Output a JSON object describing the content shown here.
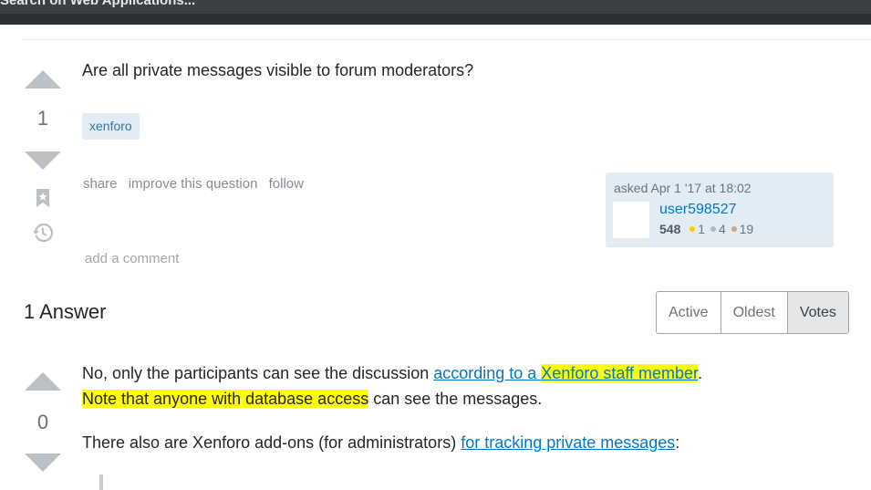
{
  "header": {
    "search_partial_text": "Search on Web Applications..."
  },
  "question": {
    "vote_count": "1",
    "title": "Are all private messages visible to forum moderators?",
    "tags": [
      "xenforo"
    ],
    "menu": {
      "share": "share",
      "improve": "improve this question",
      "follow": "follow"
    },
    "add_comment": "add a comment",
    "asked": {
      "label": "asked Apr 1 '17 at 18:02",
      "user_name": "user598527",
      "reputation": "548",
      "gold": "1",
      "silver": "4",
      "bronze": "19",
      "badge_colors": {
        "gold": "#ffcc01",
        "silver": "#b4b8bc",
        "bronze": "#d1a684"
      }
    }
  },
  "answers": {
    "heading": "1 Answer",
    "sort_tabs": [
      "Active",
      "Oldest",
      "Votes"
    ],
    "selected_tab": "Votes"
  },
  "answer": {
    "vote_count": "0",
    "line1_prefix": "No, only the participants can see the discussion ",
    "line1_link_a": "according to a ",
    "line1_link_b": "Xenforo staff member",
    "line1_suffix": ".",
    "line2_highlight": "Note that anyone with database access",
    "line2_suffix": " can see the messages.",
    "line3_prefix": "There also are Xenforo add-ons (for administrators) ",
    "line3_link": "for tracking private messages",
    "line3_suffix": ":"
  },
  "colors": {
    "highlight": "#ffff00",
    "link": "#0077cc",
    "tag_bg": "#e1ecf4"
  }
}
